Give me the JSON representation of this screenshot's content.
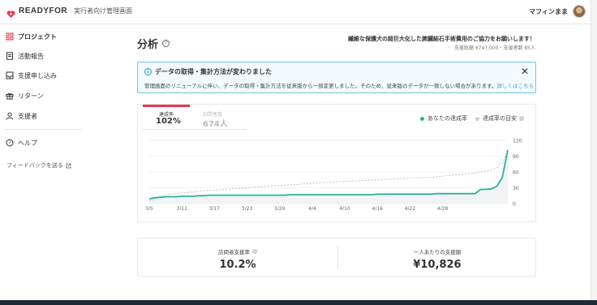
{
  "header": {
    "brand": "READYFOR",
    "subtitle": "実行者向け管理画面",
    "user_name": "マフィンまま"
  },
  "sidebar": {
    "items": [
      {
        "label": "プロジェクト",
        "icon": "grid-icon",
        "active": true
      },
      {
        "label": "活動報告",
        "icon": "document-icon",
        "active": false
      },
      {
        "label": "支援申し込み",
        "icon": "inbox-icon",
        "active": false
      },
      {
        "label": "リターン",
        "icon": "gift-icon",
        "active": false
      },
      {
        "label": "支援者",
        "icon": "person-icon",
        "active": false
      }
    ],
    "help": "ヘルプ",
    "feedback": "フィードバックを送る"
  },
  "page": {
    "title": "分析",
    "project_title": "繊維な保護犬の超巨大化した脾臓結石手術費用のご協力をお願いします！",
    "project_stats": "支援総額 ¥747,000・支援者数 85人"
  },
  "notice": {
    "title": "データの取得・集計方法が変わりました",
    "body": "管理画面のリニューアルに伴い、データの取得・集計方法を従来版から一部変更しました。そのため、従来版のデータが一致しない場合があります。",
    "link": "詳しくはこちら"
  },
  "tabs": [
    {
      "label": "達成率",
      "value": "102%",
      "active": true
    },
    {
      "label": "訪問者数",
      "value": "674人",
      "active": false
    }
  ],
  "legend": {
    "actual": "あなたの達成率",
    "target": "達成率の目安"
  },
  "colors": {
    "actual": "#2bb39c",
    "target": "#cfcfcf",
    "accent": "#e83a4d",
    "info": "#2a9fd0"
  },
  "chart_data": {
    "type": "line",
    "x_ticks": [
      "3/5",
      "3/11",
      "3/17",
      "3/23",
      "3/29",
      "4/4",
      "4/10",
      "4/16",
      "4/22",
      "4/28"
    ],
    "y_ticks": [
      0,
      30,
      60,
      90,
      120
    ],
    "ylim": [
      0,
      120
    ],
    "series": [
      {
        "name": "あなたの達成率",
        "values": [
          9,
          11,
          12,
          13,
          13,
          13,
          14,
          14,
          14,
          15,
          15,
          16,
          16,
          16,
          16,
          16,
          16,
          16,
          16,
          16,
          16,
          16,
          16,
          16,
          16,
          16,
          17,
          17,
          17,
          17,
          17,
          17,
          17,
          17,
          17,
          17,
          17,
          17,
          17,
          17,
          17,
          17,
          18,
          18,
          18,
          18,
          18,
          18,
          18,
          18,
          18,
          18,
          18,
          19,
          19,
          19,
          19,
          19,
          19,
          19,
          19,
          27,
          27,
          28,
          33,
          50,
          102
        ]
      },
      {
        "name": "達成率の目安",
        "values": [
          5,
          9,
          14,
          17,
          18,
          19,
          20,
          21,
          22,
          23,
          24,
          25,
          26,
          26,
          27,
          28,
          29,
          29,
          30,
          31,
          32,
          32,
          33,
          34,
          34,
          35,
          36,
          36,
          37,
          38,
          38,
          39,
          40,
          40,
          41,
          42,
          42,
          43,
          43,
          44,
          44,
          45,
          45,
          46,
          46,
          47,
          47,
          48,
          48,
          49,
          49,
          50,
          50,
          51,
          52,
          53,
          54,
          55,
          56,
          57,
          58,
          60,
          62,
          64,
          68,
          78,
          100
        ]
      }
    ]
  },
  "stats": [
    {
      "label": "訪問者支援率",
      "value": "10.2%"
    },
    {
      "label": "一人あたりの支援額",
      "value": "¥10,826"
    }
  ]
}
